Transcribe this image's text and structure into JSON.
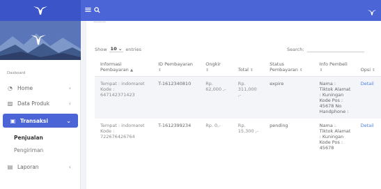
{
  "app": {
    "logo_icon": "tiktok-wing-logo",
    "brand_color": "#4b65d6",
    "active_color": "#4b65d6"
  },
  "topbar": {
    "menu_icon": "hamburger-icon",
    "search_icon": "search-icon"
  },
  "sidebar": {
    "section_label": "Dasboard",
    "items": [
      {
        "label": "Home",
        "icon": "gauge-icon",
        "has_chevron": true
      },
      {
        "label": "Data Produk",
        "icon": "image-icon",
        "has_chevron": true
      },
      {
        "label": "Transaksi",
        "icon": "bag-icon",
        "active": true,
        "expanded": true
      },
      {
        "label": "Laporan",
        "icon": "document-icon",
        "has_chevron": true
      }
    ],
    "sub_items": [
      {
        "label": "Penjualan",
        "selected": true
      },
      {
        "label": "Pengiriman",
        "selected": false
      }
    ]
  },
  "table_controls": {
    "show_label": "Show",
    "show_value": "10",
    "entries_label": "entries",
    "search_label": "Search:"
  },
  "table": {
    "headers": [
      {
        "label": "Informasi Pembayaran",
        "sort": "▲"
      },
      {
        "label": "ID Pembayaran",
        "sort": "⇕"
      },
      {
        "label": "Ongkir",
        "sort": "⇕"
      },
      {
        "label": "Total",
        "sort": "⇕"
      },
      {
        "label": "Status Pembayaran",
        "sort": "⇕"
      },
      {
        "label": "Info Pembeli",
        "sort": "⇕"
      },
      {
        "label": "Opsi",
        "sort": "⇕"
      }
    ],
    "rows": [
      {
        "info": "Tempat : indomaret Kode : 647142371423",
        "id": "T-1612340810",
        "ongkir": "Rp. 62,000 ,-",
        "total": "Rp. 311,000 ,-",
        "status": "expire",
        "pembeli": "Nama : Tiktok Alamat : Kuningan Kode Pos : 45678 No Handphone :",
        "opsi": "Detail"
      },
      {
        "info": "Tempat : indomaret Kode : 722676426764",
        "id": "T-1612399234",
        "ongkir": "Rp. 0,-",
        "total": "Rp. 15,300 ,-",
        "status": "pending",
        "pembeli": "Nama : Tiktok Alamat : Kuningan Kode Pos : 45678",
        "opsi": "Detail"
      }
    ]
  }
}
